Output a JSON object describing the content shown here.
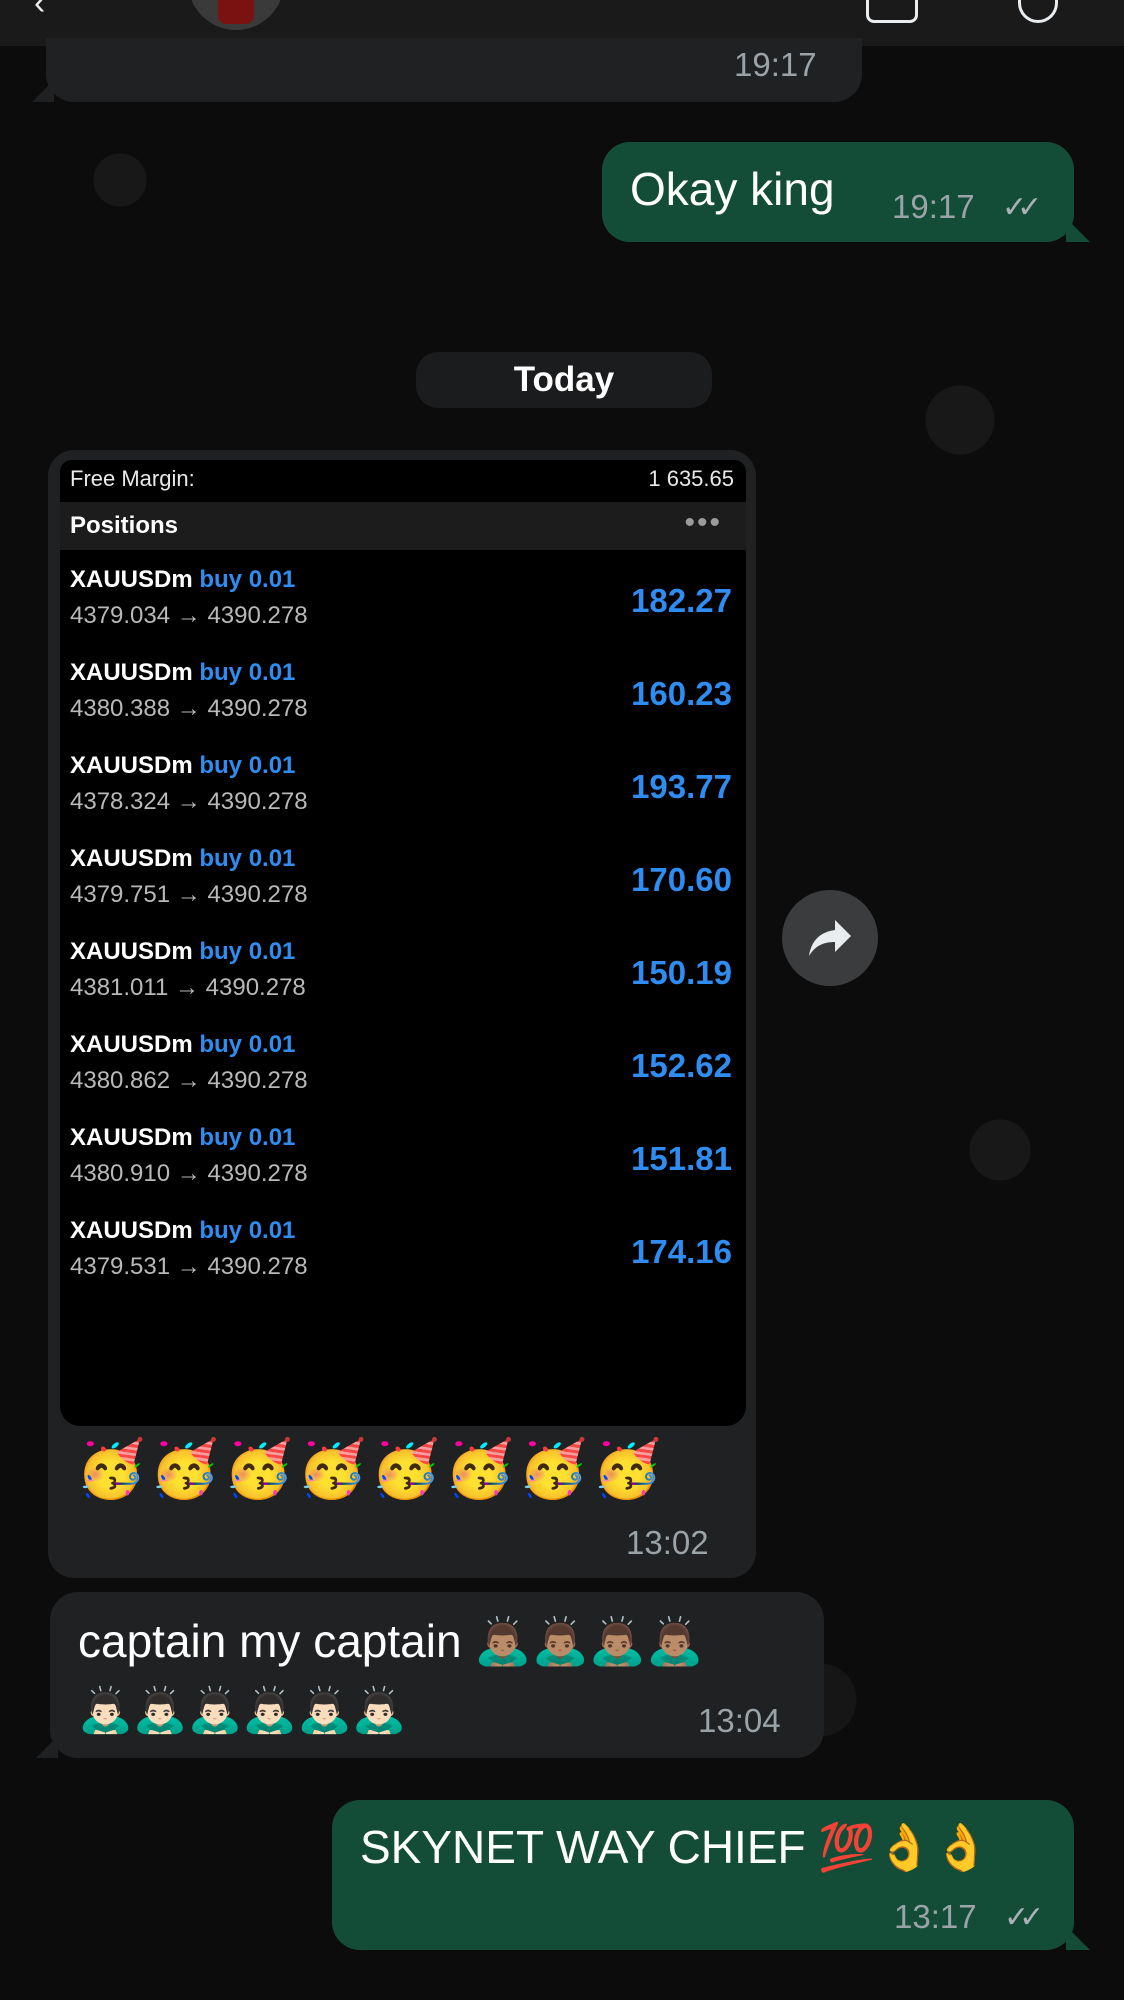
{
  "messages": {
    "prev_time": "19:17",
    "okay": {
      "text": "Okay king",
      "time": "19:17",
      "ticks": "✓✓"
    },
    "date_divider": "Today",
    "screenshot": {
      "free_margin_label": "Free Margin:",
      "free_margin_value": "1 635.65",
      "positions_title": "Positions",
      "menu_dots": "•••",
      "positions": [
        {
          "symbol": "XAUUSDm",
          "side": "buy 0.01",
          "prices": "4379.034 → 4390.278",
          "profit": "182.27"
        },
        {
          "symbol": "XAUUSDm",
          "side": "buy 0.01",
          "prices": "4380.388 → 4390.278",
          "profit": "160.23"
        },
        {
          "symbol": "XAUUSDm",
          "side": "buy 0.01",
          "prices": "4378.324 → 4390.278",
          "profit": "193.77"
        },
        {
          "symbol": "XAUUSDm",
          "side": "buy 0.01",
          "prices": "4379.751 → 4390.278",
          "profit": "170.60"
        },
        {
          "symbol": "XAUUSDm",
          "side": "buy 0.01",
          "prices": "4381.011 → 4390.278",
          "profit": "150.19"
        },
        {
          "symbol": "XAUUSDm",
          "side": "buy 0.01",
          "prices": "4380.862 → 4390.278",
          "profit": "152.62"
        },
        {
          "symbol": "XAUUSDm",
          "side": "buy 0.01",
          "prices": "4380.910 → 4390.278",
          "profit": "151.81"
        },
        {
          "symbol": "XAUUSDm",
          "side": "buy 0.01",
          "prices": "4379.531 → 4390.278",
          "profit": "174.16"
        }
      ]
    },
    "image_caption": {
      "emojis": "🥳🥳🥳🥳🥳🥳🥳🥳",
      "time": "13:02"
    },
    "captain": {
      "line1": "captain my captain 🙇🏽‍♂️🙇🏽‍♂️🙇🏽‍♂️🙇🏽‍♂️",
      "line2": "🙇🏻‍♂️🙇🏻‍♂️🙇🏻‍♂️🙇🏻‍♂️🙇🏻‍♂️🙇🏻‍♂️",
      "time": "13:04"
    },
    "skynet": {
      "text": "SKYNET WAY CHIEF 💯👌👌",
      "time": "13:17",
      "ticks": "✓✓"
    }
  },
  "icons": {
    "forward": "forward-arrow-icon",
    "back": "chevron-left-icon",
    "video": "video-call-icon",
    "call": "phone-icon"
  },
  "colors": {
    "incoming_bubble": "#1f2123",
    "outgoing_bubble": "#144d37",
    "profit_blue": "#2f8cf0"
  }
}
